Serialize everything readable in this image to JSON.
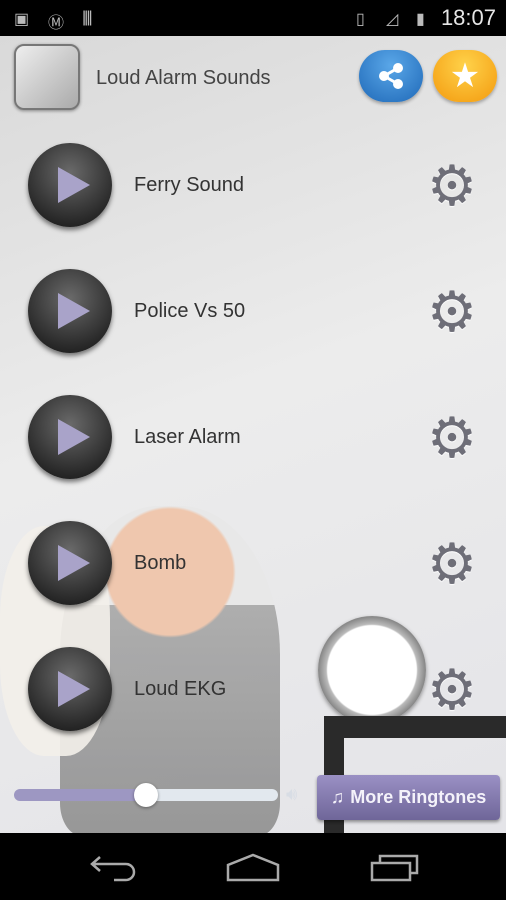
{
  "status_bar": {
    "time": "18:07",
    "icons": [
      "gallery-icon",
      "motorola-icon",
      "barcode-icon",
      "sim-blocked-icon",
      "signal-icon",
      "battery-charging-icon"
    ]
  },
  "header": {
    "title": "Loud Alarm Sounds",
    "share_icon": "share-icon",
    "rate_icon": "star-icon"
  },
  "sounds": [
    {
      "name": "Ferry Sound"
    },
    {
      "name": "Police Vs 50"
    },
    {
      "name": "Laser Alarm"
    },
    {
      "name": "Bomb"
    },
    {
      "name": "Loud EKG"
    }
  ],
  "player": {
    "volume": 0.5
  },
  "more_button": {
    "label": "More Ringtones"
  },
  "colors": {
    "accent": "#9d97c2",
    "share": "#2f80cf",
    "rate": "#f7b21f"
  }
}
